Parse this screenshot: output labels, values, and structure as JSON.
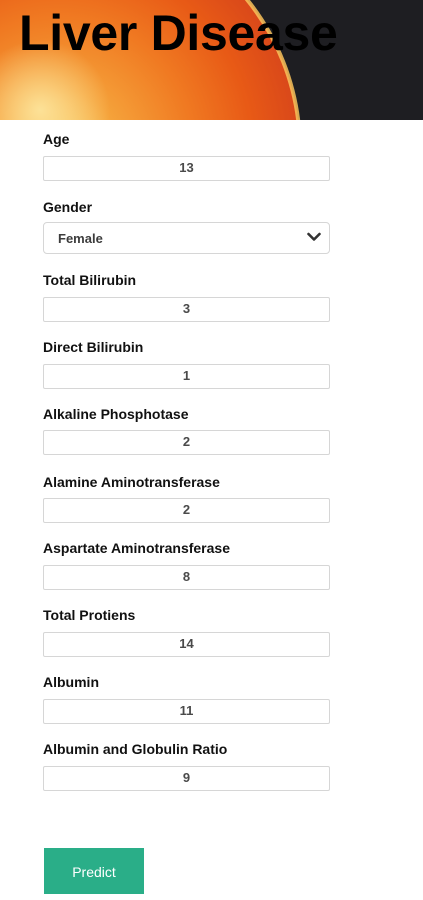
{
  "header": {
    "title": "Liver Disease"
  },
  "form": {
    "age": {
      "label": "Age",
      "value": "13"
    },
    "gender": {
      "label": "Gender",
      "value": "Female"
    },
    "total_bilirubin": {
      "label": "Total Bilirubin",
      "value": "3"
    },
    "direct_bilirubin": {
      "label": "Direct Bilirubin",
      "value": "1"
    },
    "alkaline_phosphotase": {
      "label": "Alkaline Phosphotase",
      "value": "2"
    },
    "alamine_aminotransferase": {
      "label": "Alamine Aminotransferase",
      "value": "2"
    },
    "aspartate_aminotransferase": {
      "label": "Aspartate Aminotransferase",
      "value": "8"
    },
    "total_protiens": {
      "label": "Total Protiens",
      "value": "14"
    },
    "albumin": {
      "label": "Albumin",
      "value": "11"
    },
    "albumin_globulin_ratio": {
      "label": "Albumin and Globulin Ratio",
      "value": "9"
    }
  },
  "actions": {
    "predict_label": "Predict"
  },
  "colors": {
    "accent": "#2aae88",
    "banner_dark": "#1e1e22",
    "banner_orange": "#f26a1e"
  },
  "icons": {
    "select_arrow": "chevron-down-icon"
  }
}
